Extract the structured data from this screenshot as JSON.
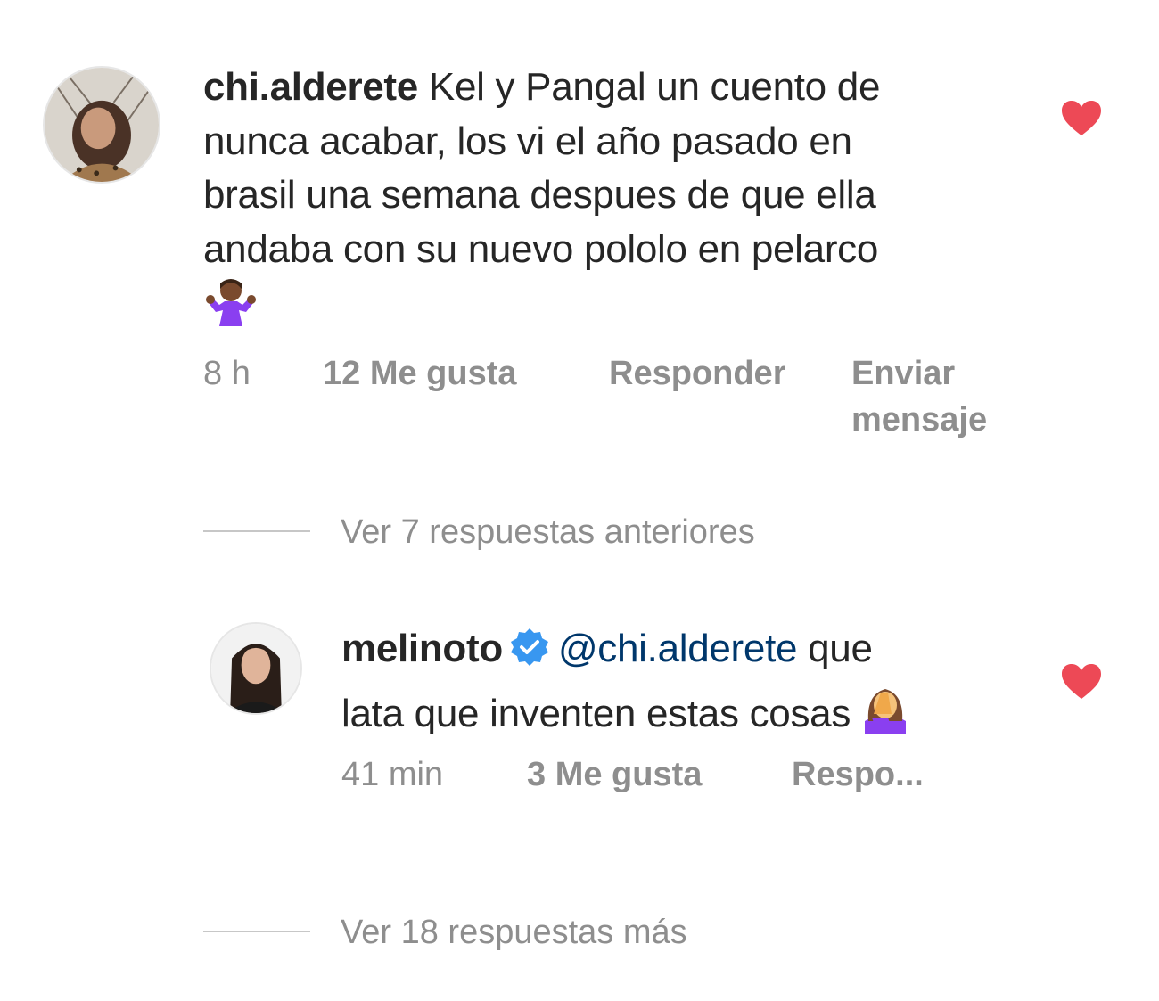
{
  "comment": {
    "username": "chi.alderete",
    "text_line1": "Kel y Pangal un cuento de",
    "text_line2": "nunca acabar, los vi el año pasado en",
    "text_line3": "brasil una semana despues de que ella",
    "text_line4": "andaba con su nuevo pololo en pelarco",
    "emoji": "person-shrugging-emoji",
    "time": "8 h",
    "likes": "12 Me gusta",
    "reply_label": "Responder",
    "send_line1": "Enviar",
    "send_line2": "mensaje",
    "liked": true
  },
  "previous_replies": "Ver 7 respuestas anteriores",
  "reply": {
    "username": "melinoto",
    "verified_icon": "verified-badge-icon",
    "mention": "@chi.alderete",
    "text_line1_rest": "que",
    "text_line2": "lata que inventen estas cosas",
    "emoji": "person-facepalming-emoji",
    "time": "41 min",
    "likes": "3 Me gusta",
    "reply_label": "Respo...",
    "liked": true
  },
  "more_replies": "Ver 18 respuestas más",
  "colors": {
    "heart": "#ed4956",
    "verified": "#3897f0",
    "meta_text": "#8e8e8e",
    "mention": "#00376b"
  }
}
